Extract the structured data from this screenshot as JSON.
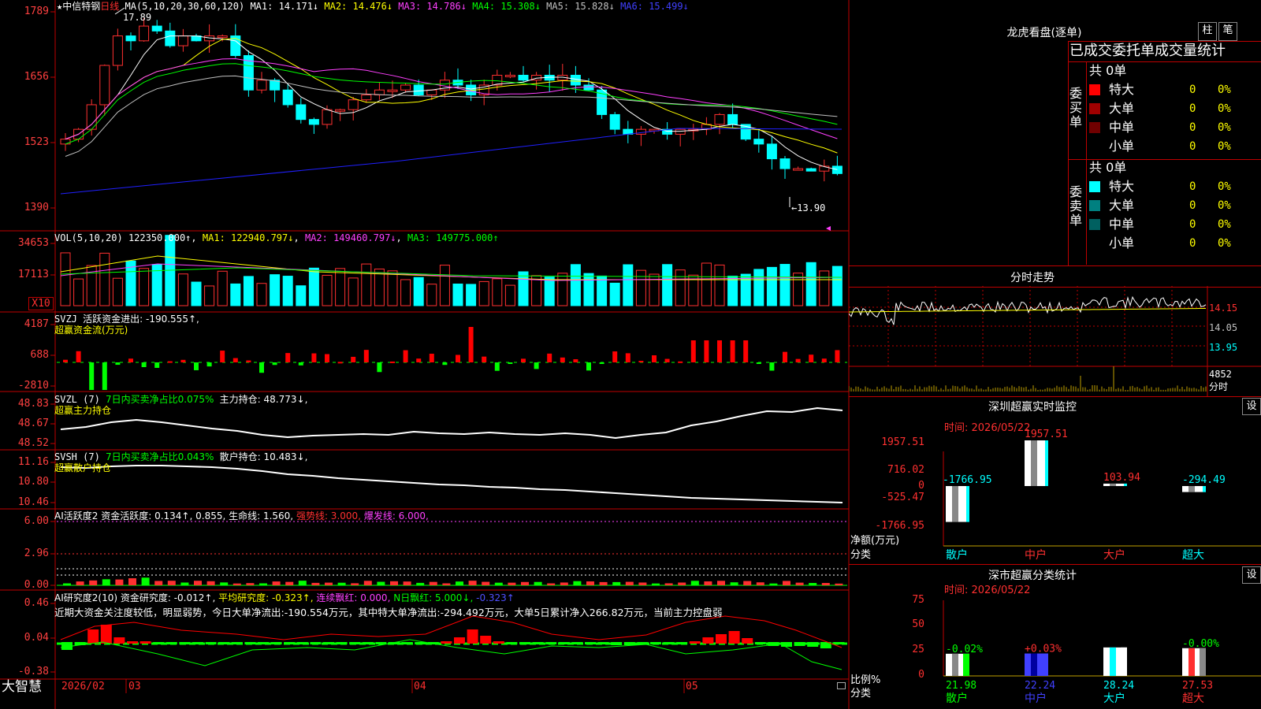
{
  "stock": {
    "name": "中信特钢",
    "period": "日线",
    "ma_label": "MA(5,10,20,30,60,120)",
    "ma": [
      {
        "k": "MA1:",
        "v": "14.171↓",
        "c": "#ffffff"
      },
      {
        "k": "MA2:",
        "v": "14.476↓",
        "c": "#ffff00"
      },
      {
        "k": "MA3:",
        "v": "14.786↓",
        "c": "#ff40ff"
      },
      {
        "k": "MA4:",
        "v": "15.308↓",
        "c": "#00ff00"
      },
      {
        "k": "MA5:",
        "v": "15.828↓",
        "c": "#c0c0c0"
      },
      {
        "k": "MA6:",
        "v": "15.499↓",
        "c": "#4040ff"
      }
    ]
  },
  "price_axis": [
    "1789",
    "1656",
    "1523",
    "1390"
  ],
  "price_marks": {
    "high": "17.89",
    "low": "13.90"
  },
  "vol": {
    "label": "VOL(5,10,20)",
    "value": "122350.000↑",
    "ma1": "MA1: 122940.797↓",
    "ma2": "MA2: 149460.797↓",
    "ma3": "MA3: 149775.000↑",
    "axis": [
      "34653",
      "17113"
    ],
    "unit": "X10"
  },
  "svzj": {
    "label": "SVZJ",
    "t1": "活跃资金进出: -190.555↑,",
    "t2": "超赢资金流(万元)",
    "axis": [
      "4187",
      "688",
      "-2810"
    ]
  },
  "svzl": {
    "label": "SVZL (7)",
    "t1": "7日内买卖净占比0.075%",
    "t2": "主力持仓: 48.773↓,",
    "t3": "超赢主力持仓",
    "axis": [
      "48.83",
      "48.67",
      "48.52"
    ]
  },
  "svsh": {
    "label": "SVSH (7)",
    "t1": "7日内买卖净占比0.043%",
    "t2": "散户持仓: 10.483↓,",
    "t3": "超赢散户持仓",
    "axis": [
      "11.16",
      "10.80",
      "10.46"
    ]
  },
  "ai_active": {
    "label": "AI活跃度2",
    "t1": "资金活跃度: 0.134↑, 0.855, 生命线: 1.560,",
    "t2": "强势线: 3.000,",
    "t3": "爆发线: 6.000,",
    "axis": [
      "6.00",
      "2.96",
      "0.00"
    ]
  },
  "ai_research": {
    "label": "AI研究度2(10)",
    "t1": "资金研究度: -0.012↑,",
    "t2": "平均研究度: -0.323↑,",
    "t3": "连续飘红: 0.000,",
    "t4": "N日飘红: 5.000↓,",
    "t5": "-0.323↑",
    "comment": "近期大资金关注度较低，明显弱势，今日大单净流出:-190.554万元，其中特大单净流出:-294.492万元，大单5日累计净入266.82万元，当前主力控盘弱",
    "axis": [
      "0.46",
      "0.04",
      "-0.38"
    ]
  },
  "dates": [
    "2026/02",
    "03",
    "04",
    "05"
  ],
  "brand": "大智慧",
  "dragon": {
    "title": "龙虎看盘(逐单)",
    "btn1": "柱",
    "btn2": "笔",
    "header": "已成交委托单成交量统计",
    "buy": {
      "side": "委买单",
      "total": "共 0单",
      "rows": [
        {
          "n": "特大",
          "a": "0",
          "p": "0%",
          "c": "#ff0000"
        },
        {
          "n": "大单",
          "a": "0",
          "p": "0%",
          "c": "#a00000"
        },
        {
          "n": "中单",
          "a": "0",
          "p": "0%",
          "c": "#700000"
        },
        {
          "n": "小单",
          "a": "0",
          "p": "0%",
          "c": ""
        }
      ]
    },
    "sell": {
      "side": "委卖单",
      "total": "共 0单",
      "rows": [
        {
          "n": "特大",
          "a": "0",
          "p": "0%",
          "c": "#00ffff"
        },
        {
          "n": "大单",
          "a": "0",
          "p": "0%",
          "c": "#008080"
        },
        {
          "n": "中单",
          "a": "0",
          "p": "0%",
          "c": "#006060"
        },
        {
          "n": "小单",
          "a": "0",
          "p": "0%",
          "c": ""
        }
      ]
    }
  },
  "intraday": {
    "title": "分时走势",
    "axis": [
      "14.15",
      "14.05",
      "13.95"
    ],
    "vol_max": "4852",
    "unit": "分时"
  },
  "monitor": {
    "title": "深圳超赢实时监控",
    "btn": "设",
    "time": "时间: 2026/05/22",
    "axis": [
      "1957.51",
      "716.02",
      "0",
      "-525.47",
      "-1766.95"
    ],
    "ylab": "净额(万元)",
    "xlab": "分类",
    "cats": [
      "散户",
      "中户",
      "大户",
      "超大"
    ],
    "vals": [
      -1766.95,
      1957.51,
      103.94,
      -294.49
    ],
    "val_labels": [
      "-1766.95",
      "1957.51",
      "103.94",
      "-294.49"
    ]
  },
  "classify": {
    "title": "深市超赢分类统计",
    "btn": "设",
    "time": "时间: 2026/05/22",
    "axis": [
      "75",
      "50",
      "25",
      "0"
    ],
    "ylab": "比例%",
    "xlab": "分类",
    "cats": [
      "散户",
      "中户",
      "大户",
      "超大"
    ],
    "vals": [
      21.98,
      22.24,
      28.24,
      27.53
    ],
    "top": [
      "-0.02%",
      "+0.03%",
      "",
      "-0.00%"
    ]
  }
}
